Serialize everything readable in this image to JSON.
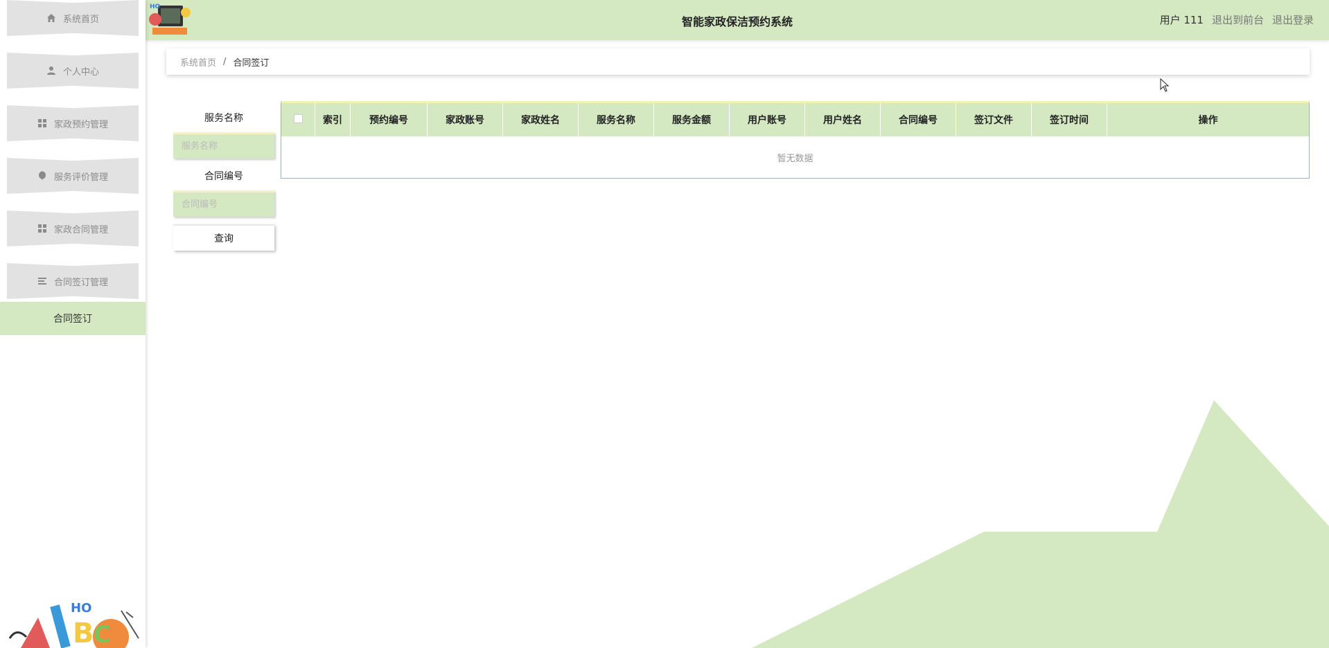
{
  "colors": {
    "accent_green": "#d4e8c2",
    "menu_gray": "#e2e2e2",
    "table_border": "#9ab0c8"
  },
  "header": {
    "title": "智能家政保洁预约系统",
    "user_label": "用户 111",
    "exit_front": "退出到前台",
    "logout": "退出登录"
  },
  "sidebar": {
    "items": [
      {
        "label": "系统首页",
        "icon": "home-icon"
      },
      {
        "label": "个人中心",
        "icon": "person-icon"
      },
      {
        "label": "家政预约管理",
        "icon": "grid-icon"
      },
      {
        "label": "服务评价管理",
        "icon": "balloon-icon"
      },
      {
        "label": "家政合同管理",
        "icon": "grid-icon"
      },
      {
        "label": "合同签订管理",
        "icon": "list-icon"
      }
    ],
    "active_sub": "合同签订"
  },
  "breadcrumb": {
    "home": "系统首页",
    "separator": "/",
    "current": "合同签订"
  },
  "search": {
    "field1_label": "服务名称",
    "field1_placeholder": "服务名称",
    "field2_label": "合同编号",
    "field2_placeholder": "合同编号",
    "button": "查询"
  },
  "table": {
    "columns": [
      "索引",
      "预约编号",
      "家政账号",
      "家政姓名",
      "服务名称",
      "服务金额",
      "用户账号",
      "用户姓名",
      "合同编号",
      "签订文件",
      "签订时间",
      "操作"
    ],
    "empty_text": "暂无数据"
  }
}
